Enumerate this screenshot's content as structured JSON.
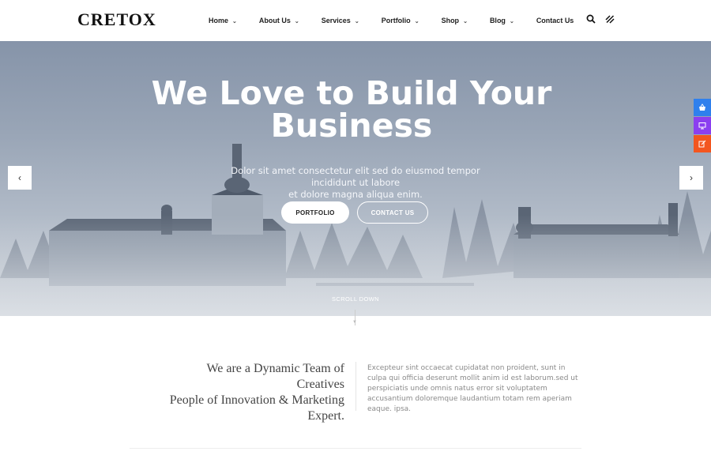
{
  "brand": {
    "logo": "CRETOX"
  },
  "nav": {
    "items": [
      {
        "label": "Home",
        "dropdown": true
      },
      {
        "label": "About Us",
        "dropdown": true
      },
      {
        "label": "Services",
        "dropdown": true
      },
      {
        "label": "Portfolio",
        "dropdown": true
      },
      {
        "label": "Shop",
        "dropdown": true
      },
      {
        "label": "Blog",
        "dropdown": true
      },
      {
        "label": "Contact Us",
        "dropdown": false
      }
    ],
    "icons": [
      "search-icon",
      "menu-toggle-icon"
    ]
  },
  "hero": {
    "title_line1": "We Love to Build Your",
    "title_line2": "Business",
    "text_line1": "Dolor sit amet consectetur elit sed do eiusmod tempor incididunt ut labore",
    "text_line2": "et dolore magna aliqua enim.",
    "primary_button": "PORTFOLIO",
    "secondary_button": "CONTACT US",
    "scroll_label": "SCROLL DOWN",
    "prev_icon": "chevron-left-icon",
    "next_icon": "chevron-right-icon"
  },
  "side_tabs": [
    {
      "icon": "basket-icon",
      "color": "#2f80ed"
    },
    {
      "icon": "monitor-icon",
      "color": "#8b3ff0"
    },
    {
      "icon": "edit-icon",
      "color": "#f3561f"
    }
  ],
  "about": {
    "tagline_line1": "We are a Dynamic Team of Creatives",
    "tagline_line2": "People of Innovation & Marketing",
    "tagline_line3": "Expert.",
    "body": "Excepteur sint occaecat cupidatat non proident, sunt in culpa qui officia deserunt mollit anim id est laborum.sed ut perspiciatis unde omnis natus error sit voluptatem accusantium doloremque laudantium totam rem aperiam eaque. ipsa."
  },
  "colors": {
    "hero_overlay": "#9aa6b7",
    "accent_blue": "#2f80ed",
    "accent_purple": "#8b3ff0",
    "accent_orange": "#f3561f"
  }
}
